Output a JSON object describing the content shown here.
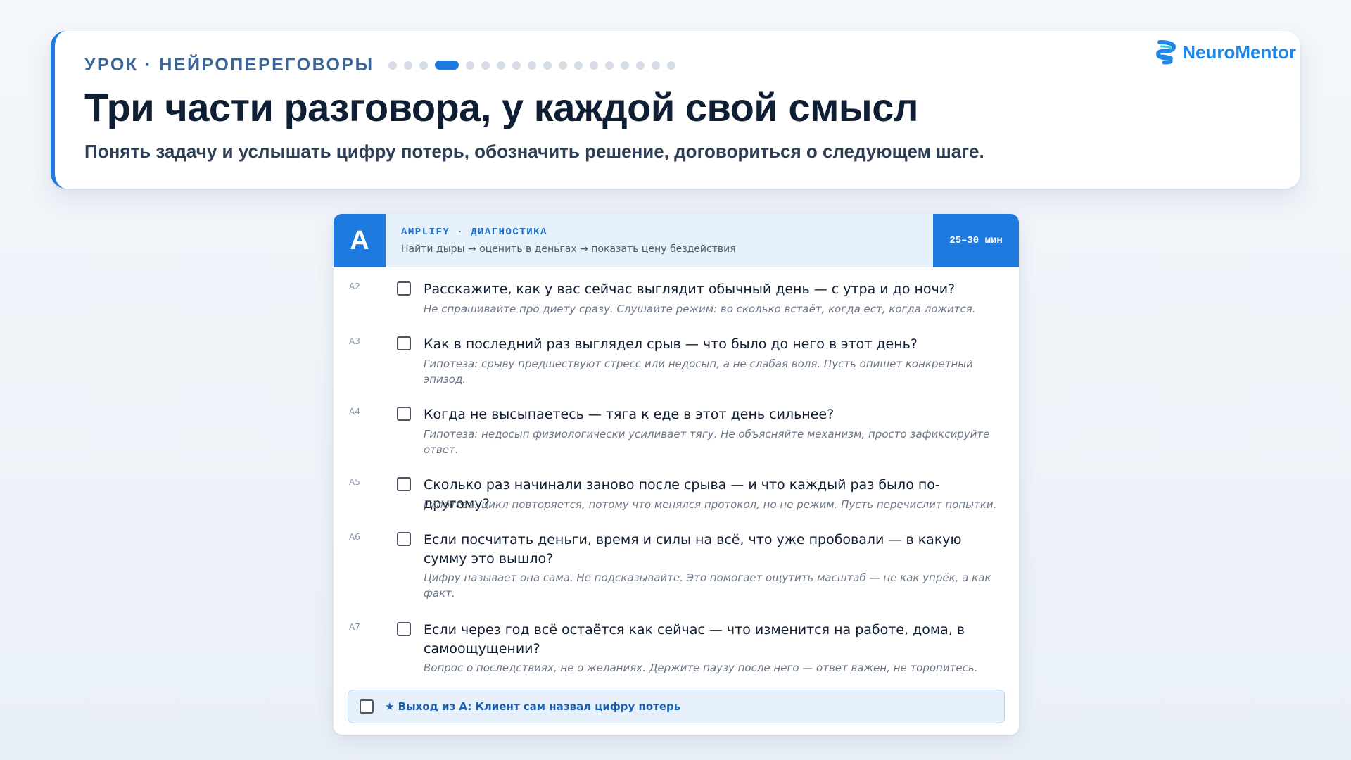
{
  "header": {
    "eyebrow": "УРОК · НЕЙРОПЕРЕГОВОРЫ",
    "title": "Три части разговора, у каждой свой смысл",
    "subtitle": "Понять задачу и услышать цифру потерь, обозначить решение, договориться о следующем шаге.",
    "progress": {
      "total_steps": 18,
      "current_step": 4
    }
  },
  "logo": {
    "text": "NeuroMentor",
    "icon": "neuromentor-logo-icon",
    "color": "#1f86e6"
  },
  "section": {
    "letter": "A",
    "tag": "AMPLIFY · ДИАГНОСТИКА",
    "flow": "Найти дыры → оценить в деньгах → показать цену бездействия",
    "time": "25–30 мин",
    "accent": "#1f7ae0",
    "questions": [
      {
        "code": "A2",
        "text": "Расскажите, как у вас сейчас выглядит обычный день — с утра и до ночи?",
        "hint": "Не спрашивайте про диету сразу. Слушайте режим: во сколько встаёт, когда ест, когда ложится."
      },
      {
        "code": "A3",
        "text": "Как в последний раз выглядел срыв — что было до него в этот день?",
        "hint": "Гипотеза: срыву предшествуют стресс или недосып, а не слабая воля. Пусть опишет конкретный эпизод."
      },
      {
        "code": "A4",
        "text": "Когда не высыпаетесь — тяга к еде в этот день сильнее?",
        "hint": "Гипотеза: недосып физиологически усиливает тягу. Не объясняйте механизм, просто зафиксируйте ответ."
      },
      {
        "code": "A5",
        "text": "Сколько раз начинали заново после срыва — и что каждый раз было по-другому?",
        "hint": "Гипотеза: цикл повторяется, потому что менялся протокол, но не режим. Пусть перечислит попытки."
      },
      {
        "code": "A6",
        "text": "Если посчитать деньги, время и силы на всё, что уже пробовали — в какую сумму это вышло?",
        "hint": "Цифру называет она сама. Не подсказывайте. Это помогает ощутить масштаб — не как упрёк, а как факт."
      },
      {
        "code": "A7",
        "text": "Если через год всё остаётся как сейчас — что изменится на работе, дома, в самоощущении?",
        "hint": "Вопрос о последствиях, не о желаниях. Держите паузу после него — ответ важен, не торопитесь."
      }
    ],
    "exit": {
      "icon": "star-icon",
      "text": "★ Выход из A: Клиент сам назвал цифру потерь"
    }
  }
}
